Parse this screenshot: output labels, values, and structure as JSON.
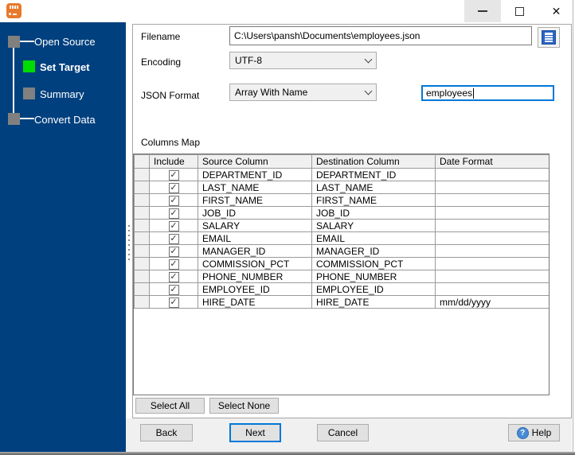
{
  "titlebar": {
    "icons": {
      "app": "converter-app-icon",
      "minimize": "—",
      "maximize": "□",
      "close": "✕"
    }
  },
  "sidebar": {
    "active_step": "Set Target",
    "steps": [
      {
        "label": "Open Source",
        "state": "done"
      },
      {
        "label": "Set Target",
        "state": "active"
      },
      {
        "label": "Summary",
        "state": "pending"
      },
      {
        "label": "Convert Data",
        "state": "pending"
      }
    ]
  },
  "form": {
    "filename_label": "Filename",
    "filename_value": "C:\\Users\\pansh\\Documents\\employees.json",
    "encoding_label": "Encoding",
    "encoding_value": "UTF-8",
    "json_format_label": "JSON Format",
    "json_format_value": "Array With Name",
    "array_name_value": "employees",
    "columns_map_label": "Columns Map"
  },
  "columns_map": {
    "headers": [
      "",
      "Include",
      "Source Column",
      "Destination Column",
      "Date Format"
    ],
    "rows": [
      {
        "include": true,
        "source": "DEPARTMENT_ID",
        "destination": "DEPARTMENT_ID",
        "date_format": ""
      },
      {
        "include": true,
        "source": "LAST_NAME",
        "destination": "LAST_NAME",
        "date_format": ""
      },
      {
        "include": true,
        "source": "FIRST_NAME",
        "destination": "FIRST_NAME",
        "date_format": ""
      },
      {
        "include": true,
        "source": "JOB_ID",
        "destination": "JOB_ID",
        "date_format": ""
      },
      {
        "include": true,
        "source": "SALARY",
        "destination": "SALARY",
        "date_format": ""
      },
      {
        "include": true,
        "source": "EMAIL",
        "destination": "EMAIL",
        "date_format": ""
      },
      {
        "include": true,
        "source": "MANAGER_ID",
        "destination": "MANAGER_ID",
        "date_format": ""
      },
      {
        "include": true,
        "source": "COMMISSION_PCT",
        "destination": "COMMISSION_PCT",
        "date_format": ""
      },
      {
        "include": true,
        "source": "PHONE_NUMBER",
        "destination": "PHONE_NUMBER",
        "date_format": ""
      },
      {
        "include": true,
        "source": "EMPLOYEE_ID",
        "destination": "EMPLOYEE_ID",
        "date_format": ""
      },
      {
        "include": true,
        "source": "HIRE_DATE",
        "destination": "HIRE_DATE",
        "date_format": "mm/dd/yyyy"
      }
    ],
    "select_all_label": "Select All",
    "select_none_label": "Select None",
    "check_glyph": "✓"
  },
  "footer": {
    "back_label": "Back",
    "next_label": "Next",
    "cancel_label": "Cancel",
    "help_label": "Help",
    "help_icon_glyph": "?"
  },
  "colors": {
    "sidebar_bg": "#00407e",
    "active_step_green": "#00dc00",
    "inactive_step_gray": "#808080",
    "accent_blue": "#0078d7",
    "footer_bg": "#f0f0f0",
    "button_bg": "#e1e1e1"
  }
}
